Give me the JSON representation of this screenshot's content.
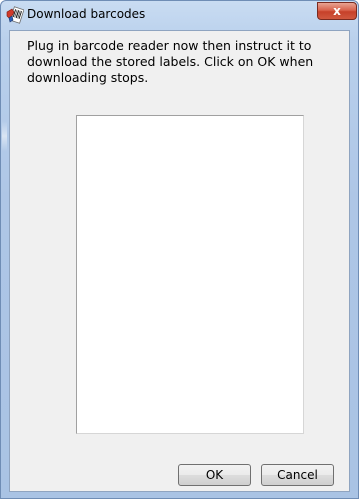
{
  "window": {
    "title": "Download barcodes",
    "icon": "barcode-app-icon"
  },
  "titlebar_buttons": {
    "close_label": "x",
    "close_icon": "close-icon"
  },
  "dialog": {
    "message": "Plug in barcode reader now then instruct it to download the stored labels. Click on OK when downloading stops.",
    "list_items": []
  },
  "buttons": {
    "ok_label": "OK",
    "cancel_label": "Cancel"
  },
  "colors": {
    "frame": "#b9d0ec",
    "client_background": "#f0f0f0",
    "close_button": "#c6412a",
    "list_background": "#ffffff"
  }
}
